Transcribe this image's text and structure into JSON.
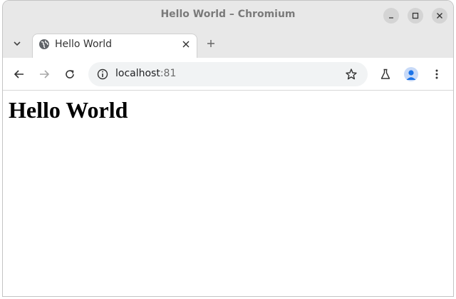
{
  "window": {
    "title": "Hello World – Chromium"
  },
  "tabs": [
    {
      "title": "Hello World",
      "active": true
    }
  ],
  "address_bar": {
    "host": "localhost",
    "port": ":81"
  },
  "page": {
    "heading": "Hello World"
  },
  "icons": {
    "tab_search": "chevron-down-icon",
    "favicon": "globe-icon",
    "tab_close": "close-icon",
    "new_tab": "plus-icon",
    "back": "arrow-left-icon",
    "forward": "arrow-right-icon",
    "reload": "reload-icon",
    "site_info": "info-icon",
    "bookmark": "star-icon",
    "labs": "flask-icon",
    "profile": "person-icon",
    "menu": "more-vertical-icon",
    "minimize": "minimize-icon",
    "maximize": "maximize-icon",
    "close_window": "close-window-icon"
  },
  "colors": {
    "titlebar": "#e8e8e8",
    "omnibox": "#f1f3f4",
    "avatar_bg": "#c8daf8",
    "avatar_fg": "#1a73e8"
  }
}
